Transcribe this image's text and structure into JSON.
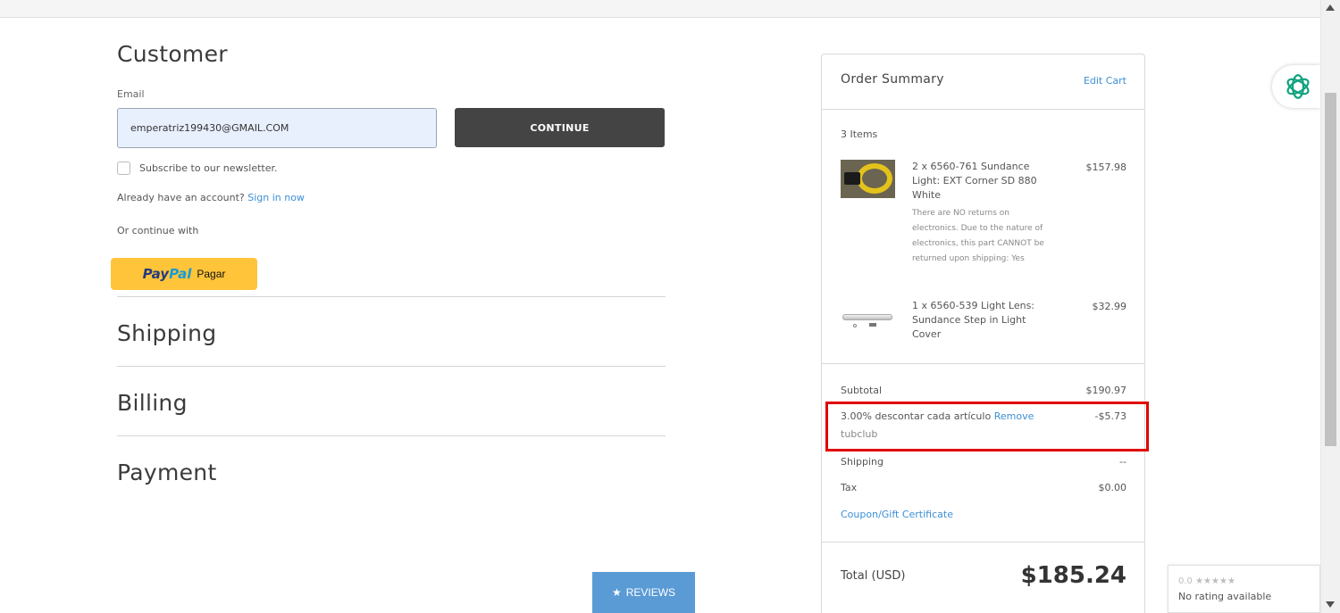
{
  "checkout": {
    "customer_title": "Customer",
    "email_label": "Email",
    "email_value": "emperatriz199430@GMAIL.COM",
    "continue_label": "CONTINUE",
    "newsletter_label": "Subscribe to our newsletter.",
    "account_text": "Already have an account?",
    "sign_in_label": "Sign in now",
    "or_continue": "Or continue with",
    "paypal_pay": "Pay",
    "paypal_pal": "Pal",
    "paypal_label": "Pagar",
    "shipping_title": "Shipping",
    "billing_title": "Billing",
    "payment_title": "Payment"
  },
  "reviews_button": {
    "icon": "★",
    "label": "REVIEWS"
  },
  "summary": {
    "title": "Order Summary",
    "edit_cart": "Edit Cart",
    "items_count": "3 Items",
    "items": [
      {
        "name": "2 x 6560-761 Sundance Light: EXT Corner SD 880 White",
        "note": "There are NO returns on electronics. Due to the nature of electronics, this part CANNOT be returned upon shipping: Yes",
        "price": "$157.98"
      },
      {
        "name": "1 x 6560-539 Light Lens: Sundance Step in Light Cover",
        "price": "$32.99"
      }
    ],
    "subtotal_label": "Subtotal",
    "subtotal_value": "$190.97",
    "discount_label": "3.00% descontar cada artículo",
    "discount_remove": "Remove",
    "discount_value": "-$5.73",
    "coupon_code": "tubclub",
    "shipping_label": "Shipping",
    "shipping_value": "--",
    "tax_label": "Tax",
    "tax_value": "$0.00",
    "coupon_link": "Coupon/Gift Certificate",
    "total_label": "Total (USD)",
    "total_value": "$185.24"
  },
  "rating_widget": {
    "score": "0.0 ★★★★★",
    "text": "No rating available"
  },
  "colors": {
    "accent_link": "#3d8fd6",
    "continue_bg": "#444444",
    "paypal_bg": "#ffc439",
    "highlight_border": "#e00000",
    "reviews_bg": "#5a9bd5"
  },
  "icons": {
    "assistant": "openai-icon",
    "star": "star-icon"
  }
}
